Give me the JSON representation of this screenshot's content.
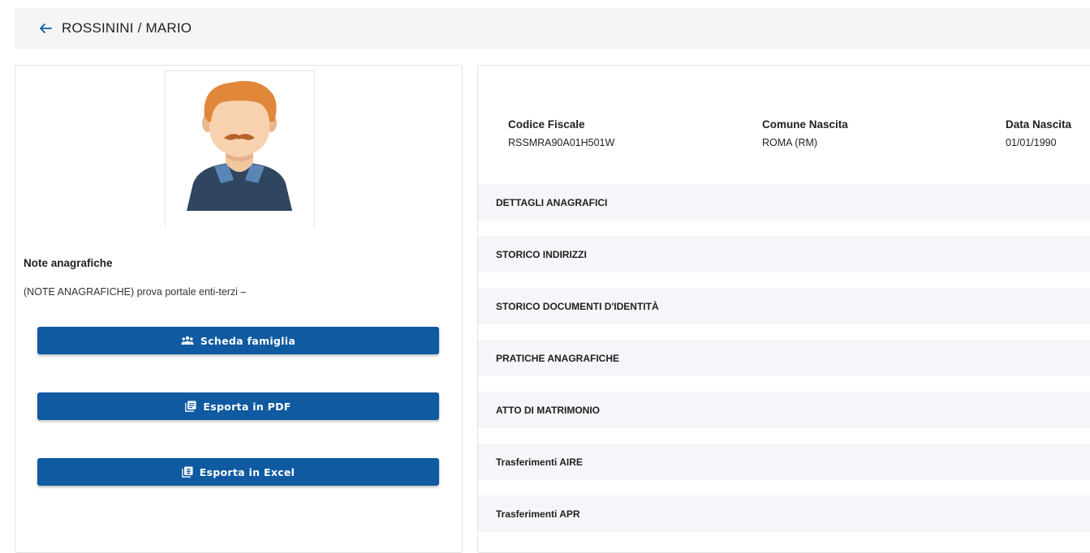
{
  "header": {
    "title": "ROSSININI / MARIO",
    "back_icon": "arrow-left-icon"
  },
  "profile": {
    "avatar_icon": "person-avatar-icon",
    "note_title": "Note anagrafiche",
    "note_text": "(NOTE ANAGRAFICHE) prova portale enti-terzi –"
  },
  "actions": {
    "family_label": "Scheda famiglia",
    "family_icon": "people-group-icon",
    "pdf_label": "Esporta in PDF",
    "pdf_icon": "pdf-icon",
    "excel_label": "Esporta in Excel",
    "excel_icon": "excel-icon"
  },
  "info": {
    "codice_fiscale_label": "Codice Fiscale",
    "codice_fiscale_value": "RSSMRA90A01H501W",
    "comune_label": "Comune Nascita",
    "comune_value": "ROMA (RM)",
    "data_label": "Data Nascita",
    "data_value": "01/01/1990"
  },
  "sections": [
    "DETTAGLI ANAGRAFICI",
    "STORICO INDIRIZZI",
    "STORICO DOCUMENTI D'IDENTITÀ",
    "PRATICHE ANAGRAFICHE",
    "ATTO DI MATRIMONIO",
    "Trasferimenti AIRE",
    "Trasferimenti APR"
  ],
  "colors": {
    "primary_button": "#0f5aa0",
    "header_bg": "#f5f5f5",
    "section_bg": "#f4f6f9"
  }
}
